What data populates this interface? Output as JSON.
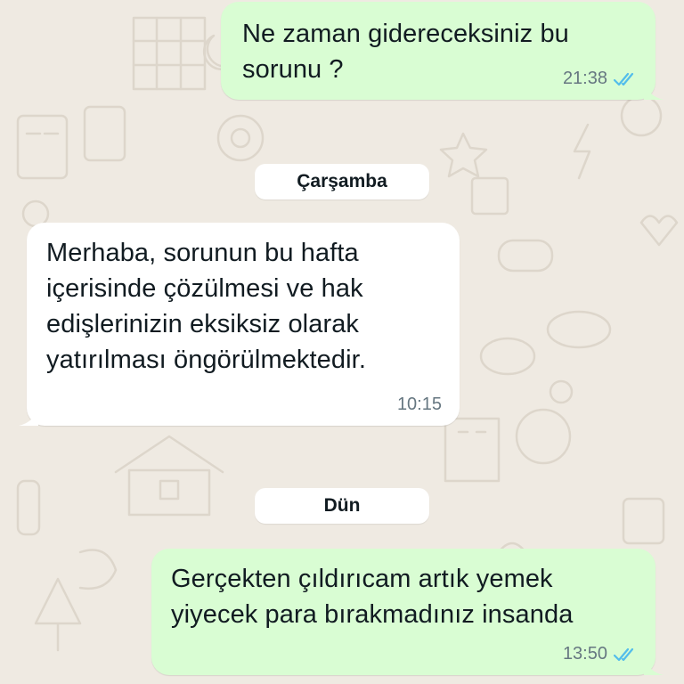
{
  "colors": {
    "background": "#efeae2",
    "outgoing_bubble": "#d9fdd3",
    "incoming_bubble": "#ffffff",
    "read_ticks": "#53bdeb",
    "meta_text": "#667781"
  },
  "messages": [
    {
      "direction": "outgoing",
      "text": "Ne zaman gidereceksiniz bu\nsorunu ?",
      "time": "21:38",
      "status_icon": "double-check-read-icon"
    },
    {
      "direction": "incoming",
      "text": "Merhaba, sorunun bu hafta\niçerisinde çözülmesi ve hak\nedişlerinizin eksiksiz olarak\nyatırılması öngörülmektedir.",
      "time": "10:15"
    },
    {
      "direction": "outgoing",
      "text": "Gerçekten çıldırıcam artık yemek\nyiyecek para bırakmadınız insanda",
      "time": "13:50",
      "status_icon": "double-check-read-icon"
    }
  ],
  "date_separators": [
    "Çarşamba",
    "Dün"
  ]
}
